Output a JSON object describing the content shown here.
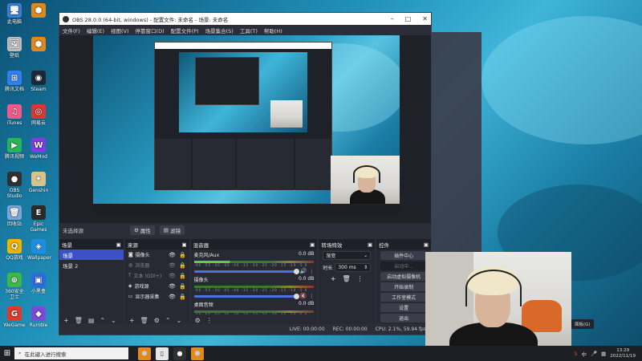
{
  "desktop": {
    "icons": [
      {
        "label": "此电脑",
        "glyph": "🖥",
        "color": "#3d7fd8"
      },
      {
        "label": "",
        "glyph": "⬢",
        "color": "#e08a1e"
      },
      {
        "label": "壁纸",
        "glyph": "🖼",
        "color": "#c0c0c0"
      },
      {
        "label": "",
        "glyph": "⬢",
        "color": "#e08a1e"
      },
      {
        "label": "腾讯文档",
        "glyph": "⊞",
        "color": "#2f80ed"
      },
      {
        "label": "Steam",
        "glyph": "◉",
        "color": "#1b2838"
      },
      {
        "label": "iTunes",
        "glyph": "♫",
        "color": "#f05a8a"
      },
      {
        "label": "网易云",
        "glyph": "◎",
        "color": "#d33a31"
      },
      {
        "label": "腾讯视频",
        "glyph": "▶",
        "color": "#27b45a"
      },
      {
        "label": "WeMod",
        "glyph": "W",
        "color": "#7b3fe4"
      },
      {
        "label": "OBS Studio",
        "glyph": "●",
        "color": "#303030"
      },
      {
        "label": "Genshin",
        "glyph": "✦",
        "color": "#d8c48a"
      },
      {
        "label": "回收站",
        "glyph": "🗑",
        "color": "#7aa7d8"
      },
      {
        "label": "Epic Games",
        "glyph": "E",
        "color": "#2a2a2a"
      },
      {
        "label": "QQ游戏",
        "glyph": "Q",
        "color": "#f0b400"
      },
      {
        "label": "Wallpaper",
        "glyph": "◈",
        "color": "#1e8fe0"
      },
      {
        "label": "360安全卫士",
        "glyph": "⊕",
        "color": "#3cb84a"
      },
      {
        "label": "小黑盒",
        "glyph": "▣",
        "color": "#2d6cdf"
      },
      {
        "label": "WeGame",
        "glyph": "G",
        "color": "#e03a2a"
      },
      {
        "label": "Rumble",
        "glyph": "◆",
        "color": "#7a4ad8"
      }
    ]
  },
  "obs": {
    "title": "OBS 28.0.0 (64-bit, windows) - 配置文件: 未命名 - 场景: 未命名",
    "menu": [
      "文件(F)",
      "编辑(E)",
      "视图(V)",
      "停靠窗口(D)",
      "配置文件(P)",
      "场景集合(S)",
      "工具(T)",
      "帮助(H)"
    ],
    "scene_bar": {
      "current": "未选择源",
      "properties_label": "属性",
      "filters_label": "滤镜"
    },
    "docks": {
      "scenes": {
        "title": "场景",
        "items": [
          "场景",
          "场景 2"
        ]
      },
      "sources": {
        "title": "来源",
        "items": [
          "摄像头",
          "浏览器",
          "文本 (GDI+)",
          "游戏源",
          "显示器采集"
        ]
      },
      "mixer": {
        "title": "混音器",
        "tracks": [
          {
            "name": "麦克风/Aux",
            "db": "0.0 dB"
          },
          {
            "name": "摄像头",
            "db": "0.0 dB"
          },
          {
            "name": "桌面音频",
            "db": "0.0 dB"
          }
        ],
        "ticks": "-60 -55 -50 -45 -40 -35 -30 -25 -20 -15 -10 -5 0"
      },
      "transitions": {
        "title": "转场特效",
        "type": "渐变",
        "duration_label": "时长",
        "duration": "300 ms"
      },
      "controls": {
        "title": "控件",
        "buttons": [
          "插件中心",
          "启动中...",
          "启动虚拟摄像机",
          "开始录制",
          "工作室模式",
          "设置",
          "退出"
        ]
      }
    },
    "status": {
      "live": "LIVE: 00:00:00",
      "rec": "REC: 00:00:00",
      "cpu": "CPU: 2.1%, 59.94 fps"
    }
  },
  "taskbar": {
    "search_placeholder": "在此键入进行搜索",
    "time": "13:29",
    "date": "2022/11/19",
    "ime": "中"
  },
  "tooltip": "面板(G)"
}
